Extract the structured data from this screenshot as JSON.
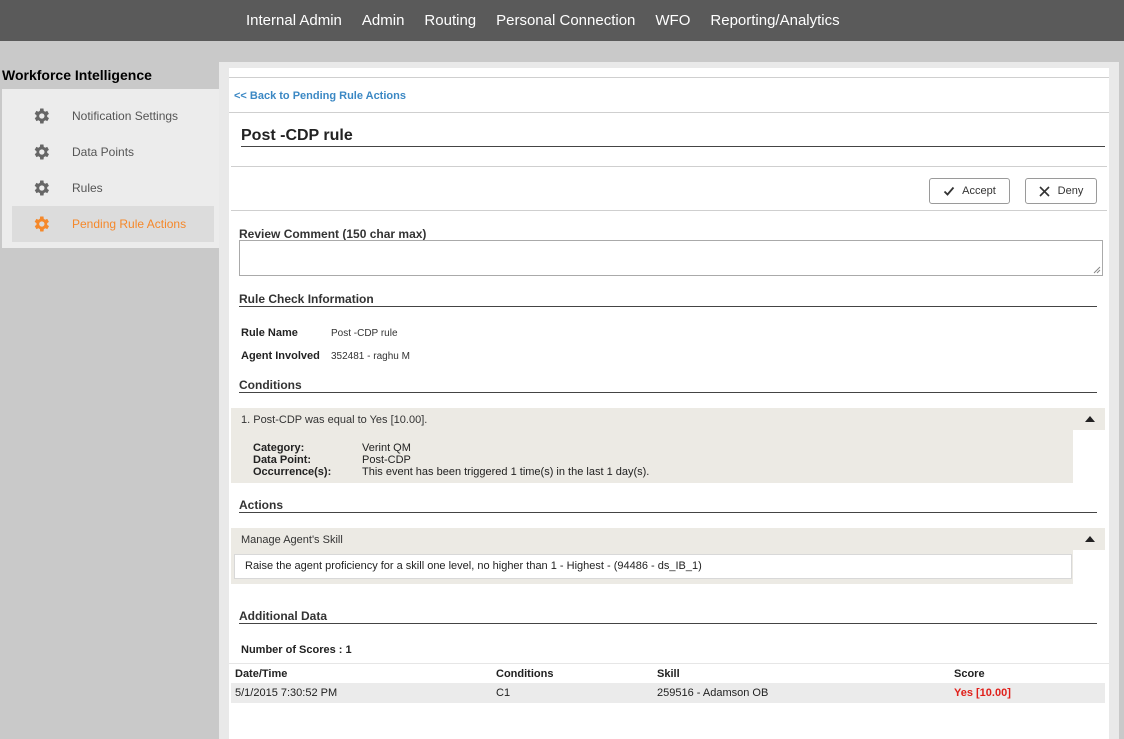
{
  "topnav": {
    "items": [
      "Internal Admin",
      "Admin",
      "Routing",
      "Personal Connection",
      "WFO",
      "Reporting/Analytics"
    ]
  },
  "sidebar": {
    "title": "Workforce Intelligence",
    "items": [
      {
        "label": "Notification Settings",
        "icon": "gear-icon"
      },
      {
        "label": "Data Points",
        "icon": "gear-icon"
      },
      {
        "label": "Rules",
        "icon": "gear-icon"
      },
      {
        "label": "Pending Rule Actions",
        "icon": "gear-icon",
        "active": true
      }
    ],
    "active_color": "#f5882a"
  },
  "main": {
    "back_link": "<< Back to Pending Rule Actions",
    "title": "Post -CDP rule",
    "accept_label": "Accept",
    "deny_label": "Deny",
    "review_comment_label": "Review Comment (150 char max)",
    "review_comment_value": "",
    "rule_check": {
      "heading": "Rule Check Information",
      "rule_name_label": "Rule Name",
      "rule_name_value": "Post -CDP rule",
      "agent_label": "Agent Involved",
      "agent_value": "352481 - raghu M"
    },
    "conditions": {
      "heading": "Conditions",
      "item_title": "1. Post-CDP was equal to Yes [10.00].",
      "category_label": "Category:",
      "category_value": "Verint QM",
      "data_point_label": "Data Point:",
      "data_point_value": "Post-CDP",
      "occurrence_label": "Occurrence(s):",
      "occurrence_value": "This event has been triggered 1 time(s) in the last 1 day(s)."
    },
    "actions": {
      "heading": "Actions",
      "item_title": "Manage Agent's Skill",
      "item_detail": "Raise the agent proficiency for a skill one level, no higher than 1 - Highest - (94486 - ds_IB_1)"
    },
    "additional": {
      "heading": "Additional Data",
      "scores_label": "Number of Scores : 1",
      "columns": [
        "Date/Time",
        "Conditions",
        "Skill",
        "Score"
      ],
      "rows": [
        {
          "datetime": "5/1/2015 7:30:52 PM",
          "conditions": "C1",
          "skill": "259516 - Adamson OB",
          "score": "Yes [10.00]"
        }
      ],
      "score_color": "#e0201b"
    }
  }
}
